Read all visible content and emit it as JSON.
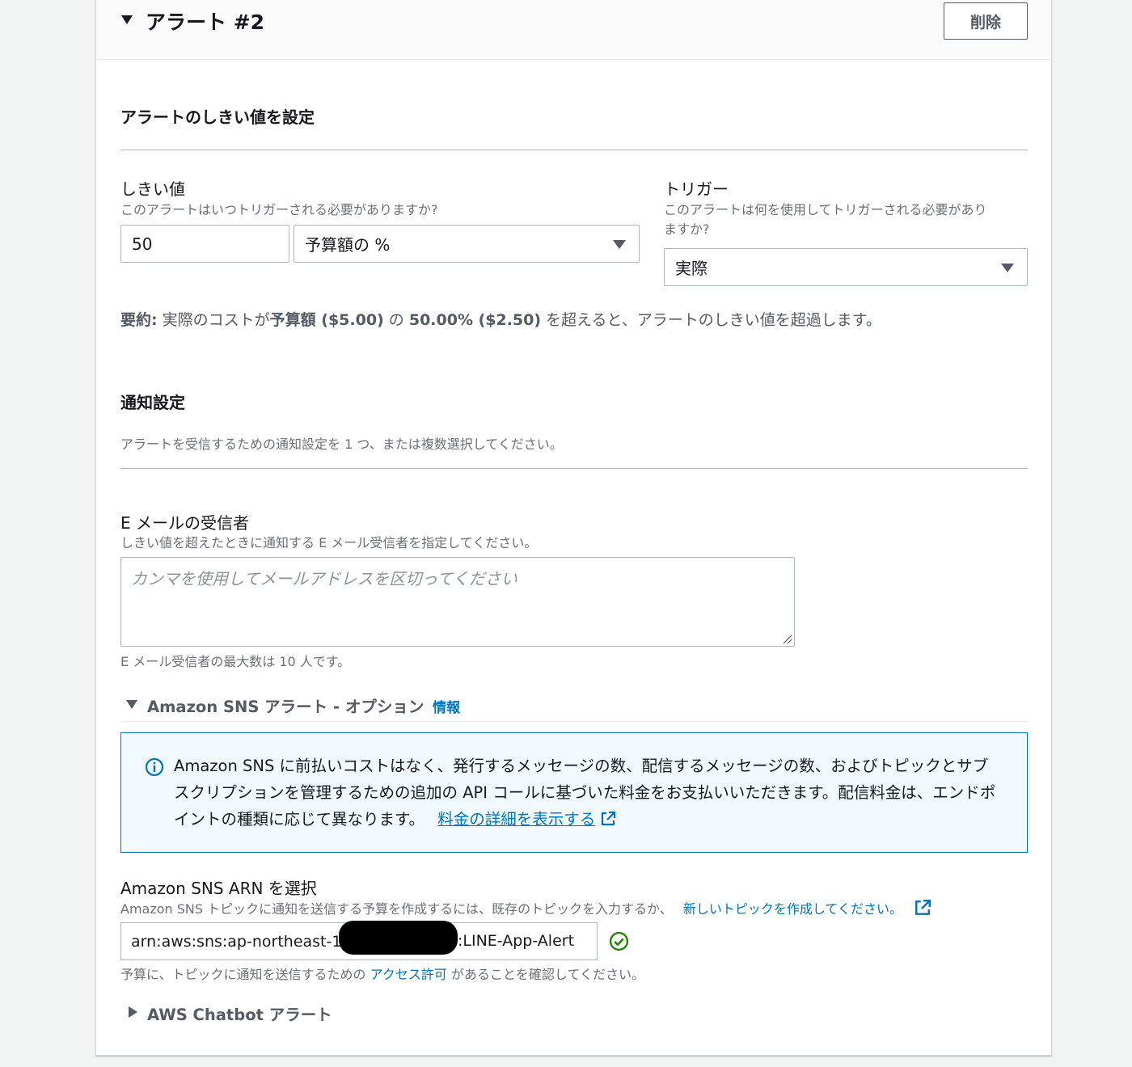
{
  "header": {
    "title": "アラート #2",
    "delete_label": "削除"
  },
  "threshold_section": {
    "heading": "アラートのしきい値を設定",
    "threshold": {
      "label": "しきい値",
      "description": "このアラートはいつトリガーされる必要がありますか?",
      "value": "50",
      "unit_selected": "予算額の %"
    },
    "trigger": {
      "label": "トリガー",
      "description_line1": "このアラートは何を使用してトリガーされる必要があり",
      "description_line2": "ますか?",
      "selected": "実際"
    },
    "summary": {
      "prefix_bold": "要約:",
      "text1": " 実際のコストが",
      "bold1": "予算額 ($5.00)",
      "text2": " の ",
      "bold2": "50.00% ($2.50)",
      "text3": " を超えると、アラートのしきい値を超過します。"
    }
  },
  "notification_section": {
    "heading": "通知設定",
    "description": "アラートを受信するための通知設定を 1 つ、または複数選択してください。",
    "email": {
      "label": "E メールの受信者",
      "description": "しきい値を超えたときに通知する E メール受信者を指定してください。",
      "placeholder": "カンマを使用してメールアドレスを区切ってください",
      "constraint": "E メール受信者の最大数は 10 人です。"
    },
    "sns": {
      "expander_label": "Amazon SNS アラート - オプション",
      "info_link": "情報",
      "info_text": "Amazon SNS に前払いコストはなく、発行するメッセージの数、配信するメッセージの数、およびトピックとサブスクリプションを管理するための追加の API コールに基づいた料金をお支払いいただきます。配信料金は、エンドポイントの種類に応じて異なります。",
      "pricing_link": "料金の詳細を表示する",
      "arn_label": "Amazon SNS ARN を選択",
      "arn_description": "Amazon SNS トピックに通知を送信する予算を作成するには、既存のトピックを入力するか、",
      "create_topic_link": "新しいトピックを作成してください。",
      "arn_value_prefix": "arn:aws:sns:ap-northeast-1:",
      "arn_value_suffix": ":LINE-App-Alert",
      "access_prefix": "予算に、トピックに通知を送信するための",
      "access_link": "アクセス許可",
      "access_suffix": "があることを確認してください。"
    },
    "chatbot": {
      "expander_label": "AWS Chatbot アラート"
    }
  },
  "colors": {
    "link": "#0073bb",
    "success": "#1d8102",
    "info_bg": "#f1faff"
  }
}
